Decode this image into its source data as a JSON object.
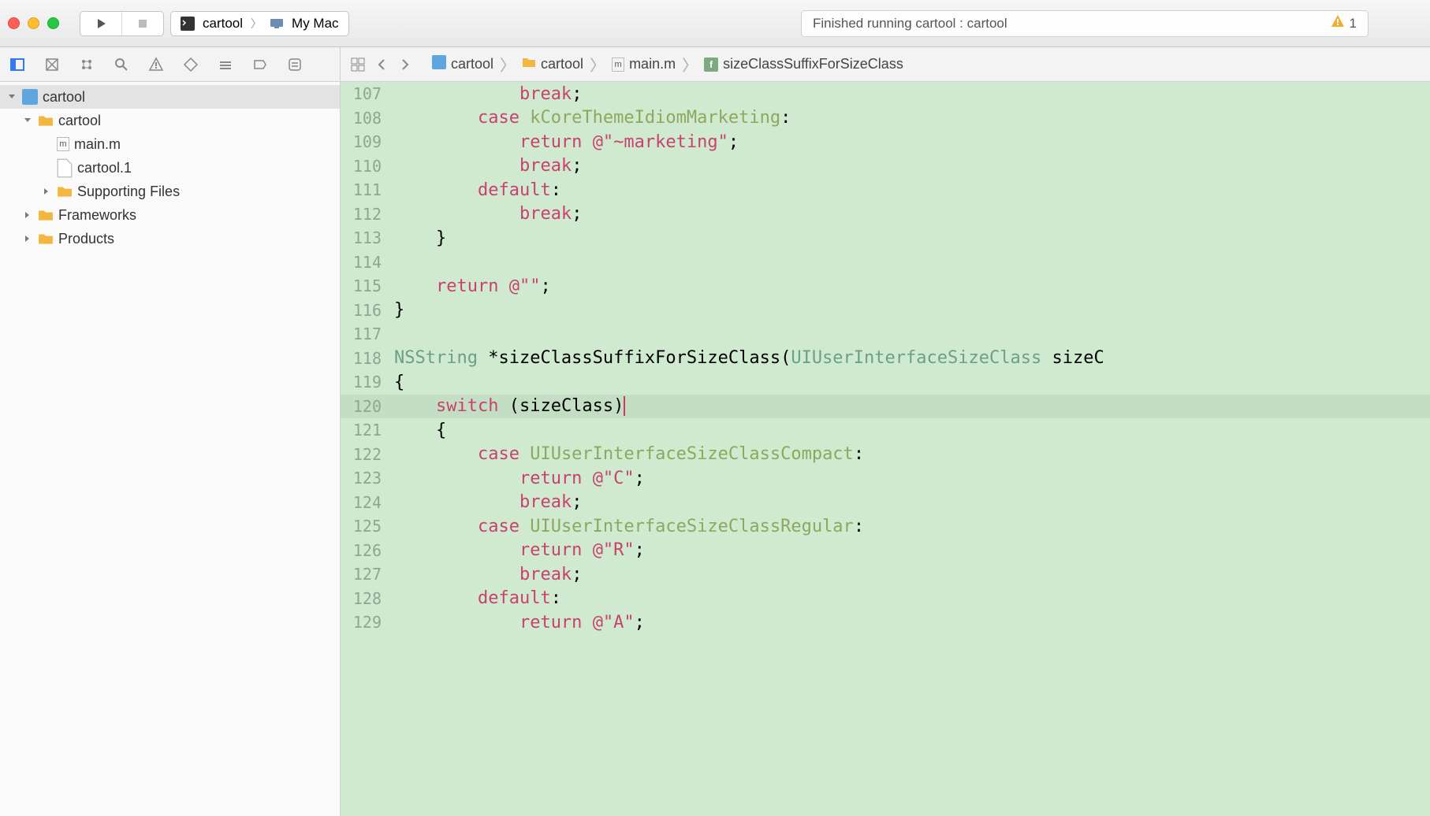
{
  "toolbar": {
    "scheme": {
      "target": "cartool",
      "device": "My Mac"
    },
    "status": {
      "text": "Finished running cartool : cartool",
      "warn_count": "1"
    }
  },
  "jumpbar": {
    "project": "cartool",
    "folder": "cartool",
    "file": "main.m",
    "symbol": "sizeClassSuffixForSizeClass"
  },
  "navigator": {
    "root": "cartool",
    "items": [
      {
        "label": "cartool",
        "type": "folder",
        "indent": 1,
        "expanded": true
      },
      {
        "label": "main.m",
        "type": "m",
        "indent": 2
      },
      {
        "label": "cartool.1",
        "type": "blank",
        "indent": 2
      },
      {
        "label": "Supporting Files",
        "type": "folder",
        "indent": 2,
        "collapsed": true
      },
      {
        "label": "Frameworks",
        "type": "folder",
        "indent": 1,
        "collapsed": true
      },
      {
        "label": "Products",
        "type": "folder",
        "indent": 1,
        "collapsed": true
      }
    ]
  },
  "editor": {
    "lines": [
      {
        "n": "107",
        "segs": [
          [
            "            ",
            ""
          ],
          [
            "break",
            "kw"
          ],
          [
            ";",
            ""
          ]
        ]
      },
      {
        "n": "108",
        "segs": [
          [
            "        ",
            ""
          ],
          [
            "case",
            "kw"
          ],
          [
            " ",
            ""
          ],
          [
            "kCoreThemeIdiomMarketing",
            "ident"
          ],
          [
            ":",
            ""
          ]
        ]
      },
      {
        "n": "109",
        "segs": [
          [
            "            ",
            ""
          ],
          [
            "return",
            "kw"
          ],
          [
            " ",
            ""
          ],
          [
            "@\"~marketing\"",
            "str"
          ],
          [
            ";",
            ""
          ]
        ]
      },
      {
        "n": "110",
        "segs": [
          [
            "            ",
            ""
          ],
          [
            "break",
            "kw"
          ],
          [
            ";",
            ""
          ]
        ]
      },
      {
        "n": "111",
        "segs": [
          [
            "        ",
            ""
          ],
          [
            "default",
            "kw"
          ],
          [
            ":",
            ""
          ]
        ]
      },
      {
        "n": "112",
        "segs": [
          [
            "            ",
            ""
          ],
          [
            "break",
            "kw"
          ],
          [
            ";",
            ""
          ]
        ]
      },
      {
        "n": "113",
        "segs": [
          [
            "    }",
            ""
          ]
        ]
      },
      {
        "n": "114",
        "segs": [
          [
            "",
            ""
          ]
        ]
      },
      {
        "n": "115",
        "segs": [
          [
            "    ",
            ""
          ],
          [
            "return",
            "kw"
          ],
          [
            " ",
            ""
          ],
          [
            "@\"\"",
            "str"
          ],
          [
            ";",
            ""
          ]
        ]
      },
      {
        "n": "116",
        "segs": [
          [
            "}",
            ""
          ]
        ]
      },
      {
        "n": "117",
        "segs": [
          [
            "",
            ""
          ]
        ]
      },
      {
        "n": "118",
        "segs": [
          [
            "NSString",
            "type"
          ],
          [
            " *sizeClassSuffixForSizeClass(",
            ""
          ],
          [
            "UIUserInterfaceSizeClass",
            "type"
          ],
          [
            " sizeC",
            ""
          ]
        ]
      },
      {
        "n": "119",
        "segs": [
          [
            "{",
            ""
          ]
        ]
      },
      {
        "n": "120",
        "segs": [
          [
            "    ",
            ""
          ],
          [
            "switch",
            "kw"
          ],
          [
            " (sizeClass)",
            ""
          ]
        ],
        "current": true
      },
      {
        "n": "121",
        "segs": [
          [
            "    {",
            ""
          ]
        ]
      },
      {
        "n": "122",
        "segs": [
          [
            "        ",
            ""
          ],
          [
            "case",
            "kw"
          ],
          [
            " ",
            ""
          ],
          [
            "UIUserInterfaceSizeClassCompact",
            "ident"
          ],
          [
            ":",
            ""
          ]
        ]
      },
      {
        "n": "123",
        "segs": [
          [
            "            ",
            ""
          ],
          [
            "return",
            "kw"
          ],
          [
            " ",
            ""
          ],
          [
            "@\"C\"",
            "str"
          ],
          [
            ";",
            ""
          ]
        ]
      },
      {
        "n": "124",
        "segs": [
          [
            "            ",
            ""
          ],
          [
            "break",
            "kw"
          ],
          [
            ";",
            ""
          ]
        ]
      },
      {
        "n": "125",
        "segs": [
          [
            "        ",
            ""
          ],
          [
            "case",
            "kw"
          ],
          [
            " ",
            ""
          ],
          [
            "UIUserInterfaceSizeClassRegular",
            "ident"
          ],
          [
            ":",
            ""
          ]
        ]
      },
      {
        "n": "126",
        "segs": [
          [
            "            ",
            ""
          ],
          [
            "return",
            "kw"
          ],
          [
            " ",
            ""
          ],
          [
            "@\"R\"",
            "str"
          ],
          [
            ";",
            ""
          ]
        ]
      },
      {
        "n": "127",
        "segs": [
          [
            "            ",
            ""
          ],
          [
            "break",
            "kw"
          ],
          [
            ";",
            ""
          ]
        ]
      },
      {
        "n": "128",
        "segs": [
          [
            "        ",
            ""
          ],
          [
            "default",
            "kw"
          ],
          [
            ":",
            ""
          ]
        ]
      },
      {
        "n": "129",
        "segs": [
          [
            "            ",
            ""
          ],
          [
            "return",
            "kw"
          ],
          [
            " ",
            ""
          ],
          [
            "@\"A\"",
            "str"
          ],
          [
            ";",
            ""
          ]
        ]
      }
    ]
  }
}
